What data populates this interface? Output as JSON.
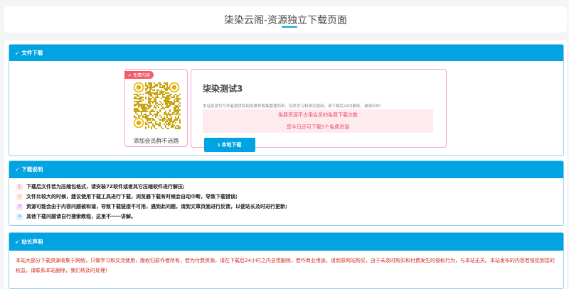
{
  "page": {
    "title": "柒染云阁-资源独立下载页面"
  },
  "accent": "#02a3e2",
  "download_panel": {
    "header": "文件下载",
    "icon": "paper-plane-icon",
    "qr": {
      "tag": "免费内容",
      "caption": "添加会员群不迷路"
    },
    "resource_title": "柒染测试3",
    "description": "本站资源均为作者提供和网友推荐收集整理而来，仅供学习和研究使用，请下载后24内删除，谢谢合作！",
    "notice": [
      "免费资源不占用会员的免费下载次数",
      "您今日还可下载5个免费资源"
    ],
    "download_button": "本地下载"
  },
  "instructions_panel": {
    "header": "下载说明",
    "items": [
      {
        "num": "1",
        "text": "下载后文件若为压缩包格式，请安装7Z软件或者其它压缩软件进行解压;",
        "color": "#f45b69",
        "bg": "#fde4e8"
      },
      {
        "num": "2",
        "text": "文件比较大的时候，建议使用下载工具进行下载，浏览器下载有时候会自动中断，导致下载错误;",
        "color": "#f5883a",
        "bg": "#feeadb"
      },
      {
        "num": "3",
        "text": "资源可能会由于内容问题被和谐，导致下载链接不可用，遇到此问题，请到文章页面进行反馈，以便站长及时进行更新;",
        "color": "#d63ad6",
        "bg": "#f9e0f9"
      },
      {
        "num": "4",
        "text": "其他下载问题请自行搜索教程，这里不一一讲解。",
        "color": "#3a8ff5",
        "bg": "#e1eefe"
      }
    ]
  },
  "statement_panel": {
    "header": "站长声明",
    "text": "本站大部分下载资源收集于网络，只做学习和交流使用，版权归原作者所有，若为付费资源，请在下载后24小时之内自觉删除，若作商业用途，请到原网站购买，由于未及时购买和付费发生的侵权行为，与本站无关。本站发布的内容若侵犯到您的权益，请联系本站删除，我们将及时处理！"
  }
}
